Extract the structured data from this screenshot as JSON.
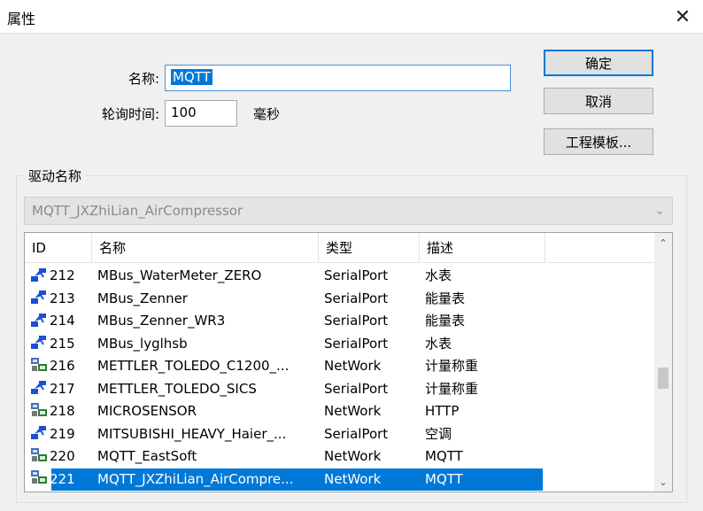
{
  "window": {
    "title": "属性",
    "close_glyph": "✕"
  },
  "form": {
    "name_label": "名称:",
    "name_value": "MQTT",
    "poll_label": "轮询时间:",
    "poll_value": "100",
    "poll_unit": "毫秒"
  },
  "buttons": {
    "ok": "确定",
    "cancel": "取消",
    "template": "工程模板..."
  },
  "driver": {
    "group_label": "驱动名称",
    "selected": "MQTT_JXZhiLian_AirCompressor"
  },
  "list": {
    "headers": {
      "id": "ID",
      "name": "名称",
      "type": "类型",
      "desc": "描述"
    },
    "rows": [
      {
        "id": "212",
        "name": "MBus_WaterMeter_ZERO",
        "type": "SerialPort",
        "desc": "水表",
        "icon": "serialport-icon"
      },
      {
        "id": "213",
        "name": "MBus_Zenner",
        "type": "SerialPort",
        "desc": "能量表",
        "icon": "serialport-icon"
      },
      {
        "id": "214",
        "name": "MBus_Zenner_WR3",
        "type": "SerialPort",
        "desc": "能量表",
        "icon": "serialport-icon"
      },
      {
        "id": "215",
        "name": "MBus_lyglhsb",
        "type": "SerialPort",
        "desc": "水表",
        "icon": "serialport-icon"
      },
      {
        "id": "216",
        "name": "METTLER_TOLEDO_C1200_...",
        "type": "NetWork",
        "desc": "计量称重",
        "icon": "network-icon"
      },
      {
        "id": "217",
        "name": "METTLER_TOLEDO_SICS",
        "type": "SerialPort",
        "desc": "计量称重",
        "icon": "serialport-icon"
      },
      {
        "id": "218",
        "name": "MICROSENSOR",
        "type": "NetWork",
        "desc": "HTTP",
        "icon": "network-icon"
      },
      {
        "id": "219",
        "name": "MITSUBISHI_HEAVY_Haier_...",
        "type": "SerialPort",
        "desc": "空调",
        "icon": "serialport-icon"
      },
      {
        "id": "220",
        "name": "MQTT_EastSoft",
        "type": "NetWork",
        "desc": "MQTT",
        "icon": "network-icon"
      },
      {
        "id": "221",
        "name": "MQTT_JXZhiLian_AirCompre...",
        "type": "NetWork",
        "desc": "MQTT",
        "icon": "network-icon",
        "selected": true
      }
    ]
  },
  "colors": {
    "selection": "#0078d7",
    "serial_icon": "#1a4fd6",
    "network_icon": "#2e7d32"
  }
}
